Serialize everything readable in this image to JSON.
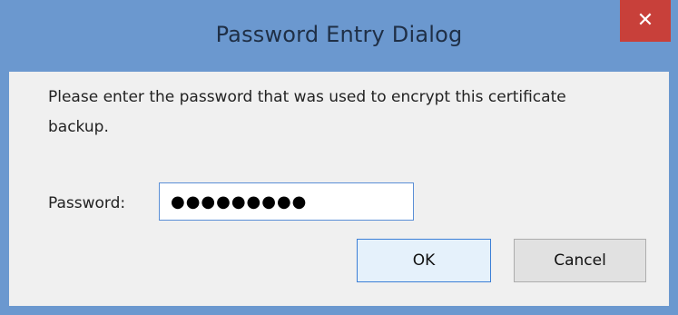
{
  "window": {
    "title": "Password Entry Dialog",
    "close_icon": "close-icon",
    "accent": "#6b98cf",
    "close_color": "#c8403a"
  },
  "dialog": {
    "message": "Please enter the password that was used to encrypt this certificate backup.",
    "password_label": "Password:",
    "password_value": "●●●●●●●●●",
    "ok_label": "OK",
    "cancel_label": "Cancel"
  }
}
